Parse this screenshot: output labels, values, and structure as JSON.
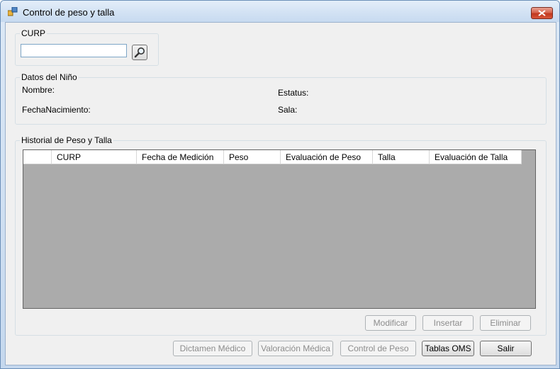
{
  "window": {
    "title": "Control de peso y talla"
  },
  "curp_group": {
    "legend": "CURP",
    "input_value": ""
  },
  "datos_group": {
    "legend": "Datos del Niño",
    "nombre_label": "Nombre:",
    "fecha_label": "FechaNacimiento:",
    "estatus_label": "Estatus:",
    "sala_label": "Sala:"
  },
  "historial_group": {
    "legend": "Historial de Peso y Talla",
    "columns": [
      "",
      "CURP",
      "Fecha de Medición",
      "Peso",
      "Evaluación de Peso",
      "Talla",
      "Evaluación de Talla"
    ],
    "rows": [],
    "buttons": {
      "modificar": "Modificar",
      "insertar": "Insertar",
      "eliminar": "Eliminar"
    }
  },
  "bottom_buttons": {
    "dictamen": "Dictamen Médico",
    "valoracion": "Valoración Médica",
    "control": "Control de Peso",
    "tablas": "Tablas OMS",
    "salir": "Salir"
  },
  "icons": {
    "app": "app-window-icon",
    "search": "search-magnifier-icon",
    "close": "close-icon"
  },
  "colors": {
    "grid_background": "#ababab",
    "title_gradient_top": "#e4eef9",
    "close_red": "#c0391f"
  }
}
